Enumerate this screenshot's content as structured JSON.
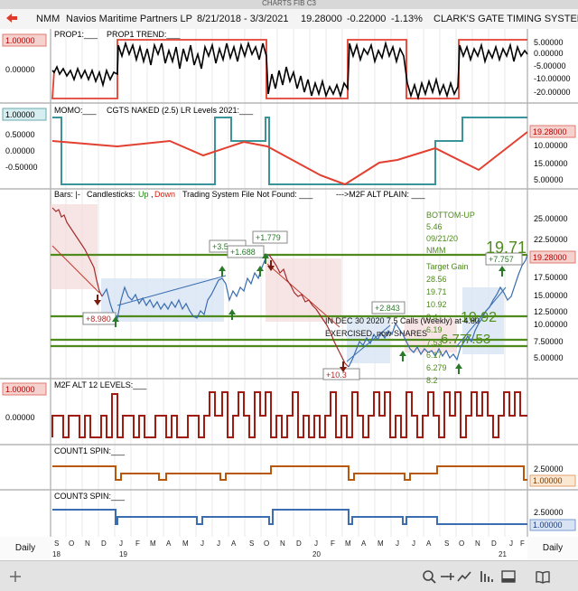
{
  "window_title": "CHARTS FIB C3",
  "header": {
    "symbol": "NMM",
    "name": "Navios Maritime Partners LP",
    "range": "8/21/2018 - 3/3/2021",
    "price": "19.28000",
    "change": "-0.22000",
    "pct": "-1.13%",
    "system": "CLARK'S GATE TIMING SYSTEM"
  },
  "panels": {
    "prop1": {
      "label1": "PROP1:___",
      "label2": "PROP1 TREND:___",
      "left_top": "1.00000",
      "left_mid": "0.00000",
      "right_ticks": [
        "5.00000",
        "0.00000",
        "-5.00000",
        "-10.00000",
        "-20.00000"
      ]
    },
    "momo": {
      "label1": "MOMO:___",
      "label2": "CGTS NAKED (2.5) LR Levels 2021:___",
      "left_ticks": [
        "1.00000",
        "0.50000",
        "0.00000",
        "-0.50000"
      ],
      "right_ticks": [
        "15.00000",
        "10.00000",
        "5.00000"
      ],
      "price_badge": "19.28000"
    },
    "bars": {
      "label_bars": "Bars: |-",
      "label_candles": "Candlesticks:",
      "label_up": "Up",
      "label_comma": ",",
      "label_down": "Down",
      "label_tsf": "Trading System File Not Found: ___",
      "label_alt": "--->M2F ALT PLAIN: ___",
      "right_ticks": [
        "25.00000",
        "22.50000",
        "17.50000",
        "15.00000",
        "12.50000",
        "10.00000",
        "7.50000",
        "5.00000"
      ],
      "price_badge": "19.28000",
      "bottom_up": [
        "BOTTOM-UP",
        "5.46",
        "09/21/20",
        "NMM"
      ],
      "target_gain": [
        "Target Gain",
        "28.56",
        "19.71",
        "10.92",
        "8.4",
        "6.19",
        "7.53",
        "6.17",
        "6.279",
        "8.2"
      ],
      "big_labels": [
        "19.71",
        "10.92",
        "6.77",
        "7.53"
      ],
      "annotation": [
        "IN DEC 30 2020 7.5 Calls (Weekly) at 4.80",
        "EXERCISED. now SHARES"
      ],
      "boxes": [
        "+3.5",
        "+1.688",
        "+1.779",
        "+8.980",
        "+2.843",
        "+10.3",
        "+7.757"
      ]
    },
    "m2f": {
      "label": "M2F ALT 12 LEVELS:___",
      "left_top": "1.00000",
      "left_mid": "0.00000"
    },
    "count1": {
      "label": "COUNT1 SPIN:___",
      "right_ticks": [
        "2.50000",
        "1.00000"
      ]
    },
    "count3": {
      "label": "COUNT3 SPIN:___",
      "right_ticks": [
        "2.50000",
        "1.00000"
      ]
    }
  },
  "x_axis": {
    "months": [
      "S",
      "O",
      "N",
      "D",
      "J",
      "F",
      "M",
      "A",
      "M",
      "J",
      "J",
      "A",
      "S",
      "O",
      "N",
      "D",
      "J",
      "F",
      "M",
      "A",
      "M",
      "J",
      "J",
      "A",
      "S",
      "O",
      "N",
      "D",
      "J",
      "F"
    ],
    "years": [
      "18",
      "19",
      "20",
      "21"
    ]
  },
  "timeframe": {
    "left": "Daily",
    "right": "Daily"
  },
  "toolbar_icons": [
    "add-icon",
    "search-icon",
    "zoom-out-icon",
    "zoom-in-icon",
    "line-chart-icon",
    "panels-icon",
    "window-icon",
    "book-icon"
  ],
  "colors": {
    "accent_red": "#d9321f",
    "teal": "#3a9499",
    "green": "#4f8a1c",
    "price_line": "#3b6db0",
    "count1": "#b8580c",
    "m2f": "#a01b12",
    "prop_box": "#e24030"
  }
}
